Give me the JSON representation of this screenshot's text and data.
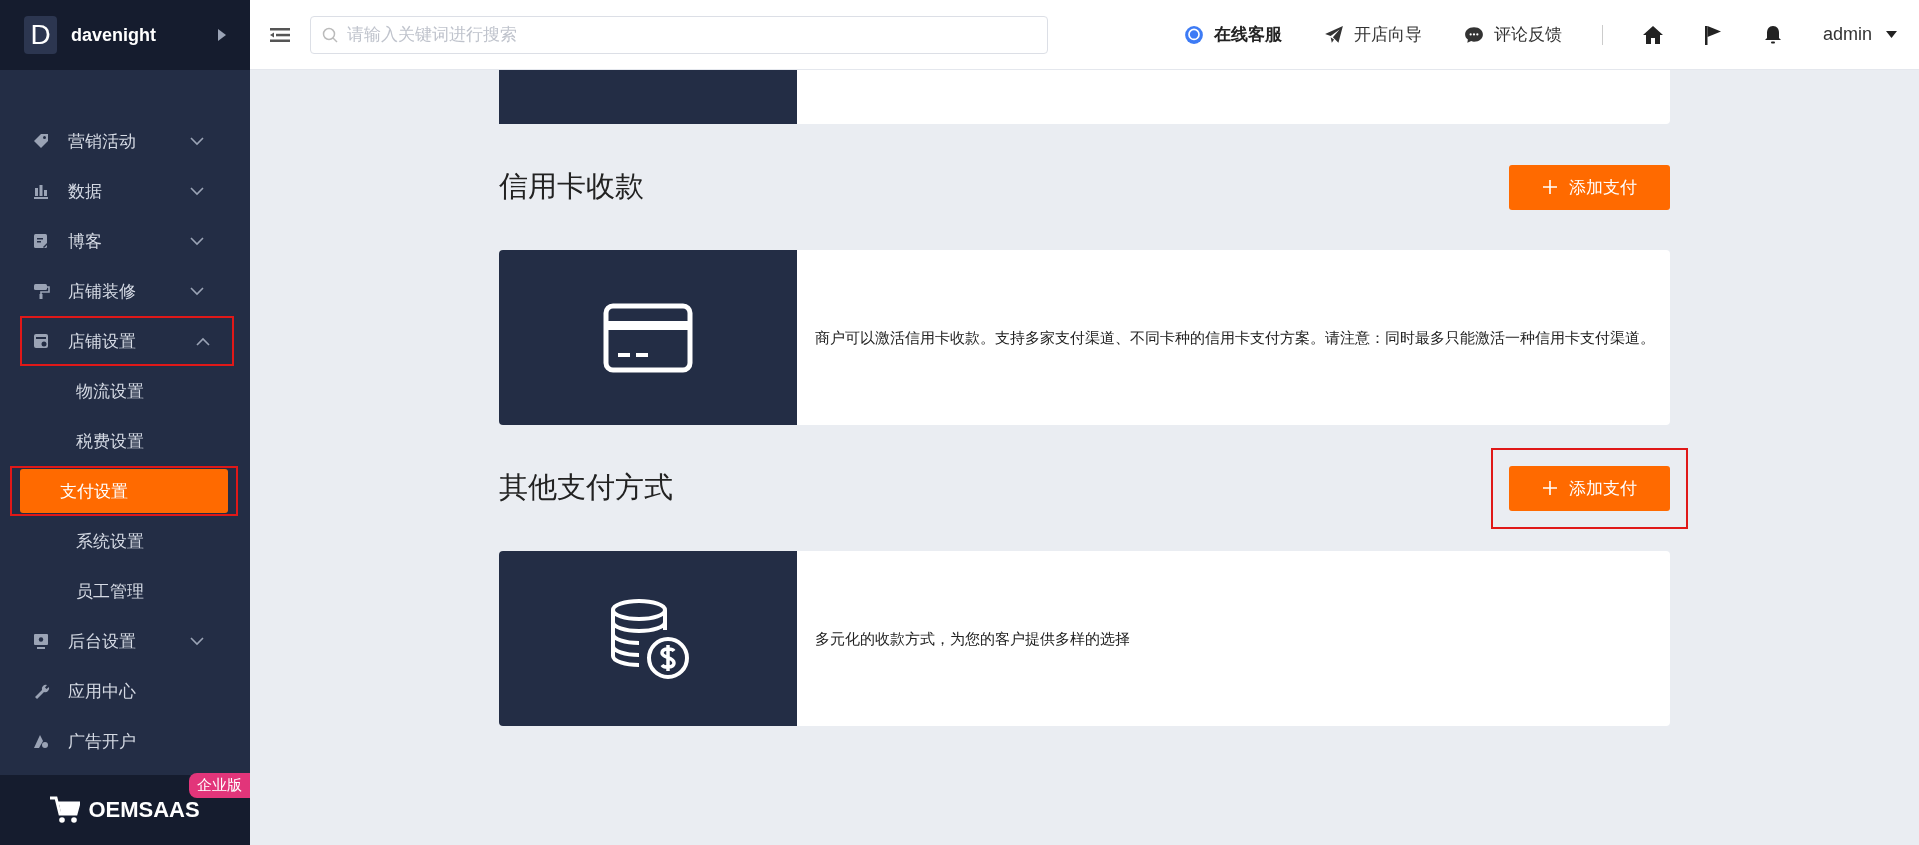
{
  "sidebar": {
    "brand": {
      "letter": "D",
      "name": "davenight"
    },
    "items": [
      {
        "label": "营销活动",
        "expanded": false,
        "highlighted": false
      },
      {
        "label": "数据",
        "expanded": false,
        "highlighted": false
      },
      {
        "label": "博客",
        "expanded": false,
        "highlighted": false
      },
      {
        "label": "店铺装修",
        "expanded": false,
        "highlighted": false
      },
      {
        "label": "店铺设置",
        "expanded": true,
        "highlighted": true,
        "children": [
          {
            "label": "物流设置",
            "selected": false,
            "highlighted": false
          },
          {
            "label": "税费设置",
            "selected": false,
            "highlighted": false
          },
          {
            "label": "支付设置",
            "selected": true,
            "highlighted": true
          },
          {
            "label": "系统设置",
            "selected": false,
            "highlighted": false
          },
          {
            "label": "员工管理",
            "selected": false,
            "highlighted": false
          }
        ]
      },
      {
        "label": "后台设置",
        "expanded": false,
        "highlighted": false
      },
      {
        "label": "应用中心",
        "highlighted": false
      },
      {
        "label": "广告开户",
        "highlighted": false
      }
    ],
    "footer": {
      "logo": "OEMSAAS",
      "badge": "企业版"
    }
  },
  "header": {
    "search": {
      "placeholder": "请输入关键词进行搜索"
    },
    "links": [
      {
        "label": "在线客服"
      },
      {
        "label": "开店向导"
      },
      {
        "label": "评论反馈"
      }
    ],
    "user": "admin"
  },
  "sections": [
    {
      "title": "信用卡收款",
      "button": "添加支付",
      "button_highlighted": false,
      "description": "商户可以激活信用卡收款。支持多家支付渠道、不同卡种的信用卡支付方案。请注意：同时最多只能激活一种信用卡支付渠道。"
    },
    {
      "title": "其他支付方式",
      "button": "添加支付",
      "button_highlighted": true,
      "description": "多元化的收款方式，为您的客户提供多样的选择"
    }
  ]
}
